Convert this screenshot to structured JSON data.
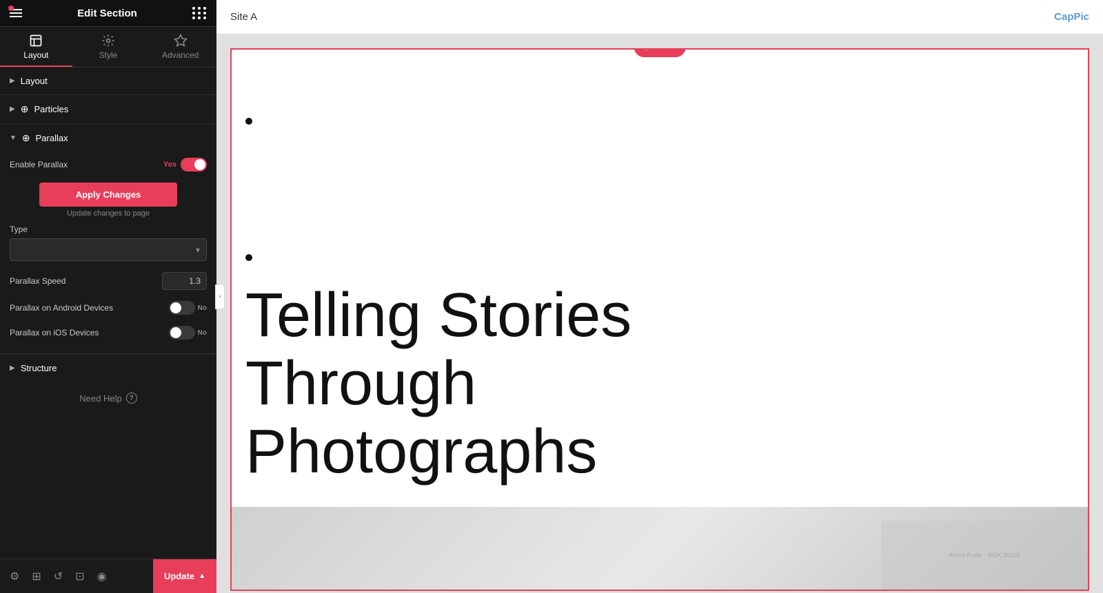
{
  "panel": {
    "title": "Edit Section",
    "tabs": [
      {
        "id": "layout",
        "label": "Layout",
        "active": true
      },
      {
        "id": "style",
        "label": "Style",
        "active": false
      },
      {
        "id": "advanced",
        "label": "Advanced",
        "active": false
      }
    ],
    "sections": [
      {
        "id": "layout",
        "label": "Layout",
        "collapsed": true
      },
      {
        "id": "particles",
        "label": "Particles",
        "collapsed": true,
        "has_icon": true
      },
      {
        "id": "parallax",
        "label": "Parallax",
        "collapsed": false,
        "has_icon": true,
        "fields": {
          "enable_parallax": {
            "label": "Enable Parallax",
            "value": true,
            "toggle_label": "Yes"
          },
          "apply_btn": "Apply Changes",
          "apply_hint": "Update changes to page",
          "type": {
            "label": "Type",
            "value": "",
            "placeholder": ""
          },
          "parallax_speed": {
            "label": "Parallax Speed",
            "value": "1.3"
          },
          "parallax_android": {
            "label": "Parallax on Android Devices",
            "value": false,
            "toggle_label": "No"
          },
          "parallax_ios": {
            "label": "Parallax on iOS Devices",
            "value": false,
            "toggle_label": "No"
          }
        }
      },
      {
        "id": "structure",
        "label": "Structure",
        "collapsed": true
      }
    ],
    "need_help": "Need Help",
    "bottom_toolbar": {
      "update_label": "Update"
    }
  },
  "canvas": {
    "site_title": "Site A",
    "brand": "CapPic",
    "section_toolbar": {
      "add": "+",
      "move": "⠿",
      "close": "×"
    },
    "content": {
      "line1": "Telling Stories",
      "line2": "Through",
      "line3": "Photographs"
    }
  }
}
